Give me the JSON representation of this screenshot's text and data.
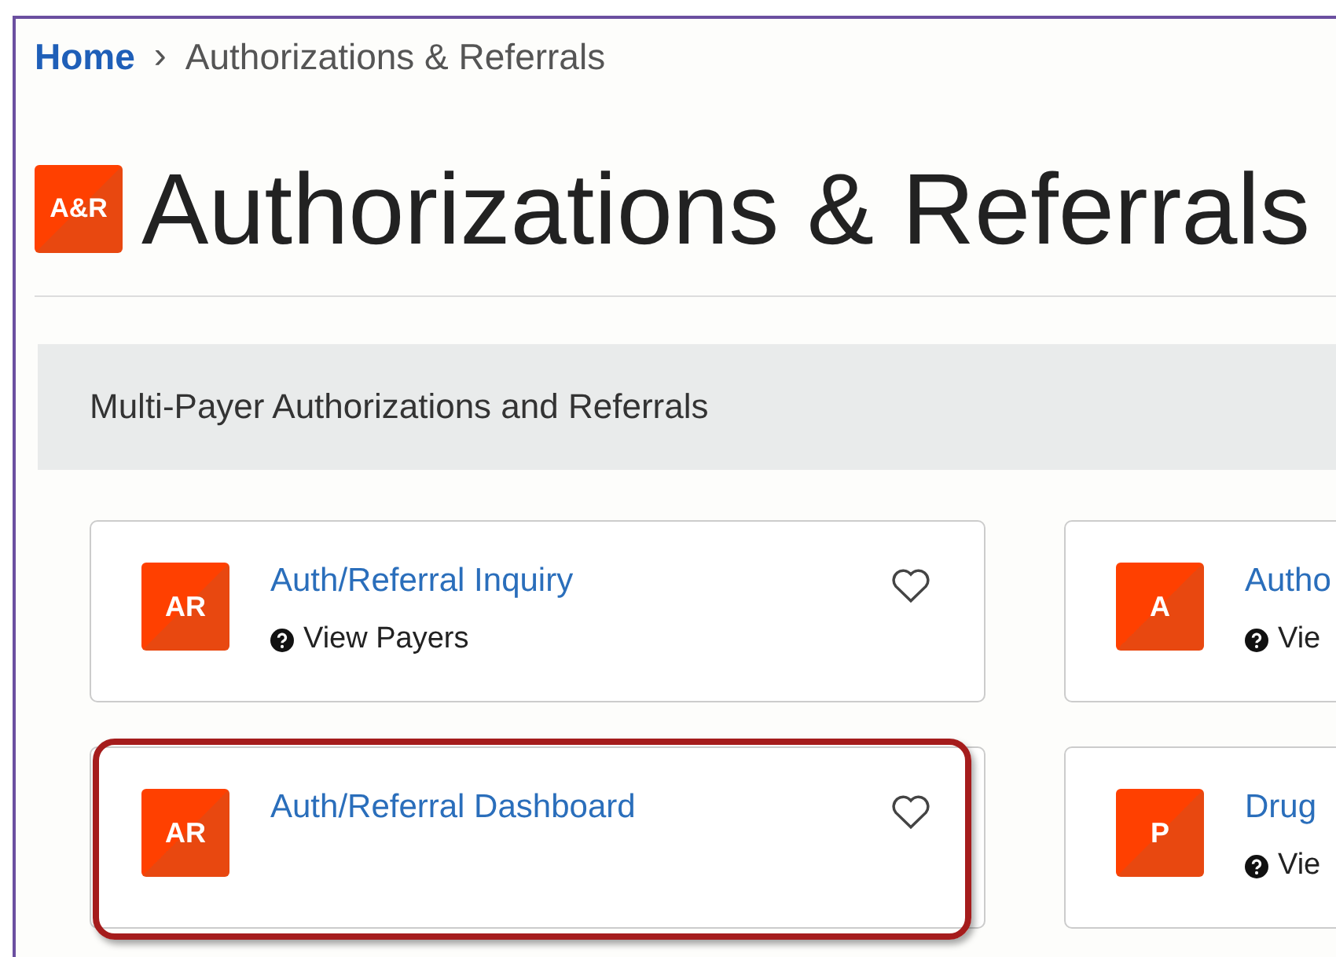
{
  "breadcrumb": {
    "home": "Home",
    "separator": "›",
    "current": "Authorizations & Referrals"
  },
  "header": {
    "logo": "A&R",
    "title": "Authorizations & Referrals"
  },
  "section": {
    "title": "Multi-Payer Authorizations and Referrals",
    "cards": [
      {
        "icon": "AR",
        "title": "Auth/Referral Inquiry",
        "help": "View Payers",
        "favorite": false,
        "highlighted": false
      },
      {
        "icon": "A",
        "title": "Autho",
        "help": "Vie",
        "highlighted": false
      },
      {
        "icon": "AR",
        "title": "Auth/Referral Dashboard",
        "favorite": false,
        "highlighted": true
      },
      {
        "icon": "P",
        "title": "Drug",
        "help": "Vie",
        "highlighted": false
      }
    ]
  }
}
